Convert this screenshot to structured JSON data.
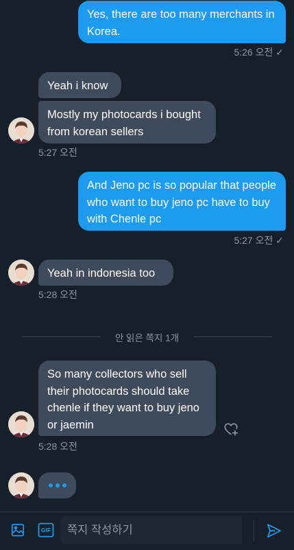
{
  "messages": [
    {
      "text": "Yes, there are too many merchants in Korea."
    },
    {
      "text": "Yeah i know"
    },
    {
      "text": "Mostly my photocards i bought from korean sellers"
    },
    {
      "text": "And Jeno pc is so popular that people who want to buy jeno pc have to buy with Chenle pc"
    },
    {
      "text": "Yeah in indonesia too"
    },
    {
      "text": "So many collectors who sell their photocards should take chenle if they want to buy jeno or jaemin"
    }
  ],
  "timestamps": {
    "t1": "5:26 오전",
    "t2": "5:27 오전",
    "t3": "5:27 오전",
    "t4": "5:28 오전",
    "t5": "5:28 오전"
  },
  "read_check": "✓",
  "divider": {
    "label": "안 읽은 쪽지 1개"
  },
  "composer": {
    "placeholder": "쪽지 작성하기",
    "gif_label": "GIF"
  },
  "icons": {
    "image": "image-icon",
    "gif": "gif-icon",
    "send": "send-icon",
    "react": "heart-plus-icon",
    "typing": "typing-indicator-icon"
  },
  "colors": {
    "background": "#15202b",
    "outgoing_bubble": "#1d9bf0",
    "incoming_bubble": "#3d4b5a",
    "muted_text": "#8b98a5",
    "accent": "#1d9bf0"
  }
}
